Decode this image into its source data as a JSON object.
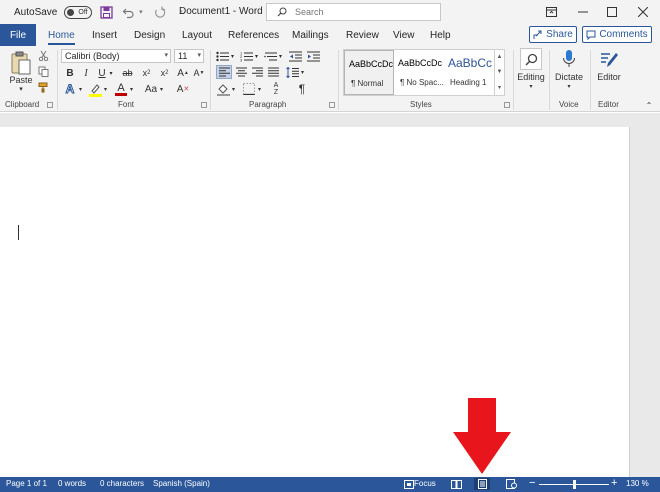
{
  "titlebar": {
    "autosave_label": "AutoSave",
    "autosave_state": "Off",
    "document_title": "Document1  -  Word",
    "search_placeholder": "Search"
  },
  "tabs": {
    "file": "File",
    "items": [
      "Home",
      "Insert",
      "Design",
      "Layout",
      "References",
      "Mailings",
      "Review",
      "View",
      "Help"
    ],
    "active": "Home",
    "share_label": "Share",
    "comments_label": "Comments"
  },
  "ribbon": {
    "clipboard": {
      "paste_label": "Paste",
      "group_label": "Clipboard"
    },
    "font": {
      "font_name": "Calibri (Body)",
      "font_size": "11",
      "group_label": "Font"
    },
    "paragraph": {
      "group_label": "Paragraph"
    },
    "styles": {
      "group_label": "Styles",
      "items": [
        {
          "sample": "AaBbCcDc",
          "name": "¶ Normal"
        },
        {
          "sample": "AaBbCcDc",
          "name": "¶ No Spac..."
        },
        {
          "sample": "AaBbCc",
          "name": "Heading 1"
        }
      ]
    },
    "editing": {
      "label": "Editing"
    },
    "voice": {
      "dictate_label": "Dictate",
      "group_label": "Voice"
    },
    "editor": {
      "label": "Editor",
      "group_label": "Editor"
    }
  },
  "statusbar": {
    "page": "Page 1 of 1",
    "words": "0 words",
    "characters": "0 characters",
    "language": "Spanish (Spain)",
    "focus": "Focus",
    "zoom": "130 %"
  },
  "colors": {
    "accent": "#2b579a",
    "highlight": "#ffff00",
    "font_color": "#c00000",
    "annotation_arrow": "#e8161c"
  }
}
